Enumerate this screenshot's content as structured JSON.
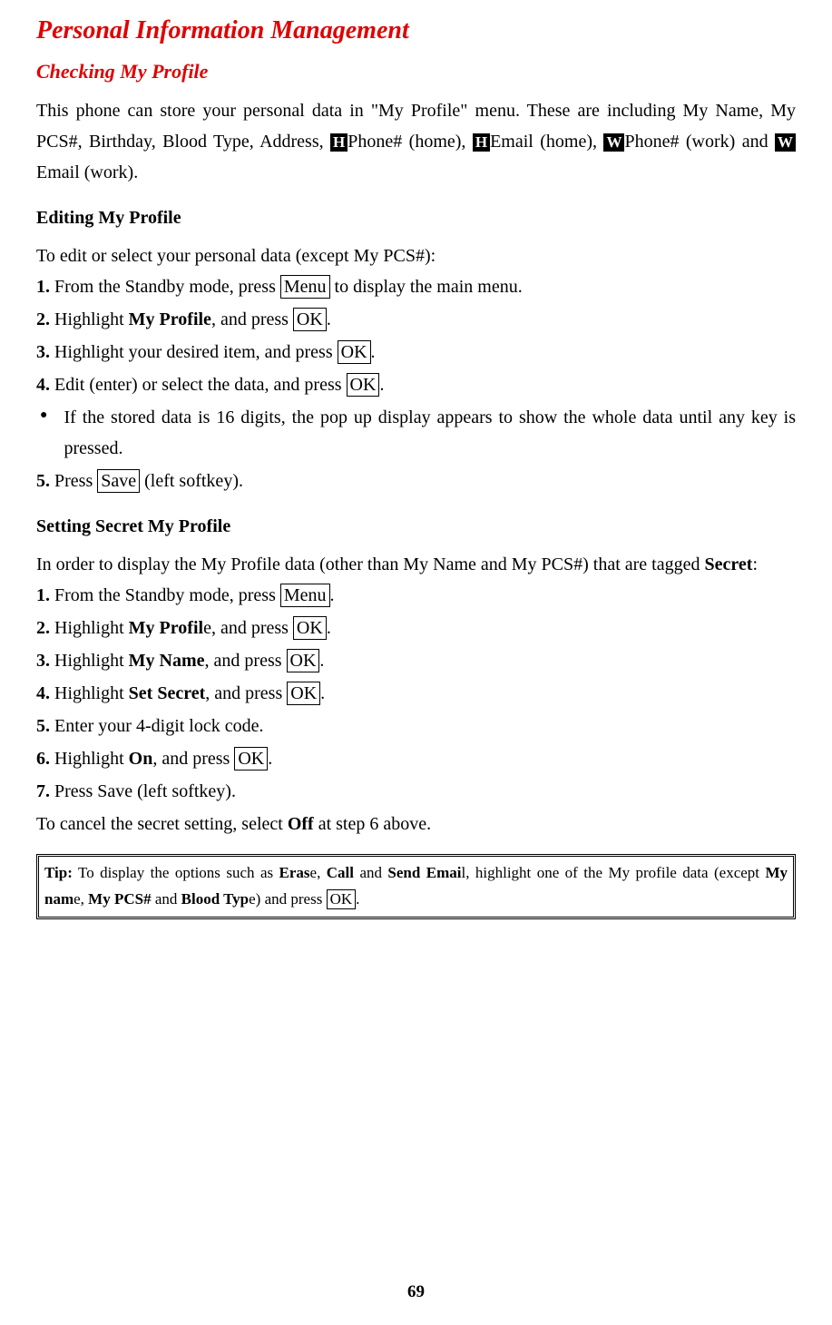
{
  "pageTitle": "Personal Information Management",
  "subsection": "Checking My Profile",
  "intro": {
    "part1": "This phone can store your personal data in \"My Profile\" menu. These are including My Name, My PCS#, Birthday, Blood Type, Address, ",
    "badgeH1": "H",
    "part2": "Phone# (home), ",
    "badgeH2": "H",
    "part3": "Email (home), ",
    "badgeW1": "W",
    "part4": "Phone# (work) and ",
    "badgeW2": "W",
    "part5": "Email (work)."
  },
  "editing": {
    "heading": "Editing My Profile",
    "lead": "To edit or select your personal data (except My PCS#):",
    "step1": {
      "num": "1.",
      "a": " From the Standby mode, press ",
      "key": "Menu",
      "b": " to display the main menu."
    },
    "step2": {
      "num": "2.",
      "a": " Highlight ",
      "bold": "My Profile",
      "b": ", and press ",
      "key": "OK",
      "c": "."
    },
    "step3": {
      "num": "3.",
      "a": " Highlight your desired item, and press ",
      "key": "OK",
      "b": "."
    },
    "step4": {
      "num": "4.",
      "a": " Edit (enter) or select the data, and press ",
      "key": "OK",
      "b": "."
    },
    "bullet": "If the stored data is 16 digits, the pop up display appears to show the whole data until any key is pressed.",
    "step5": {
      "num": "5.",
      "a": " Press ",
      "key": "Save",
      "b": " (left softkey)."
    }
  },
  "secret": {
    "heading": "Setting Secret My Profile",
    "leadA": "In order to display the My Profile data (other than My Name and My PCS#) that are tagged ",
    "leadBold": "Secret",
    "leadB": ":",
    "step1": {
      "num": "1.",
      "a": " From the Standby mode, press ",
      "key": "Menu",
      "b": "."
    },
    "step2": {
      "num": "2.",
      "a": " Highlight ",
      "bold": "My Profil",
      "a2": "e, and press ",
      "key": "OK",
      "b": "."
    },
    "step3": {
      "num": "3.",
      "a": " Highlight ",
      "bold": "My Name",
      "a2": ", and press ",
      "key": "OK",
      "b": "."
    },
    "step4": {
      "num": "4.",
      "a": " Highlight ",
      "bold": "Set Secret",
      "a2": ", and press ",
      "key": "OK",
      "b": "."
    },
    "step5": {
      "num": "5.",
      "a": " Enter your 4-digit lock code."
    },
    "step6": {
      "num": "6.",
      "a": " Highlight ",
      "bold": "On",
      "a2": ", and press ",
      "key": "OK",
      "b": "."
    },
    "step7": {
      "num": "7.",
      "a": " Press Save (left softkey)."
    },
    "cancelA": "To cancel the secret setting, select ",
    "cancelBold": "Off",
    "cancelB": " at step 6 above."
  },
  "tip": {
    "label": "Tip:",
    "a": " To display the options such as ",
    "b1": "Eras",
    "b1a": "e, ",
    "b2": "Call",
    "b2a": " and ",
    "b3": "Send Emai",
    "b3a": "l, highlight one of the My profile data (except ",
    "b4": "My nam",
    "b4a": "e, ",
    "b5": "My PCS#",
    "b5a": " and ",
    "b6": "Blood Typ",
    "b6a": "e) and press ",
    "key": "OK",
    "end": "."
  },
  "pageNumber": "69"
}
